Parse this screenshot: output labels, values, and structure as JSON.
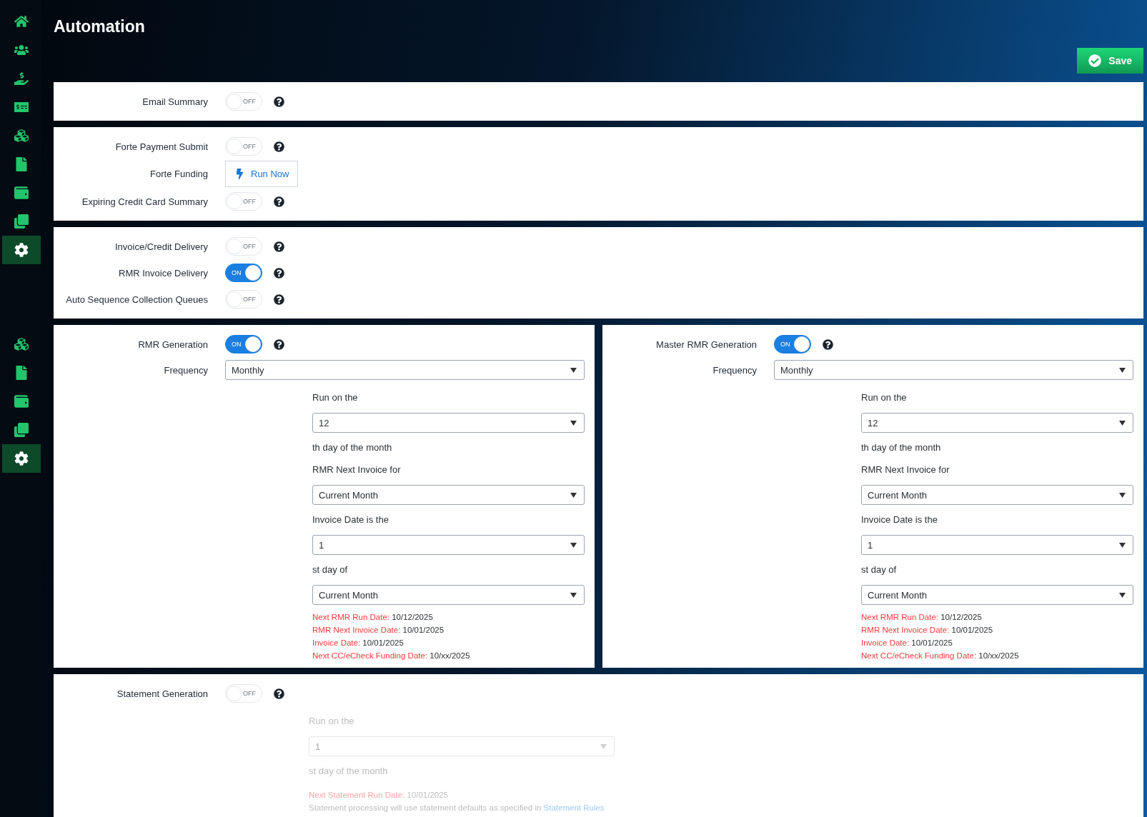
{
  "page": {
    "title": "Automation"
  },
  "save_button": {
    "label": "Save"
  },
  "sidebar": {
    "groups": [
      {
        "items": [
          {
            "kind": "home",
            "selected": false
          },
          {
            "kind": "users",
            "selected": false
          },
          {
            "kind": "payment",
            "selected": false
          },
          {
            "kind": "billing",
            "selected": false
          },
          {
            "kind": "inventory",
            "selected": false
          },
          {
            "kind": "document",
            "selected": false
          },
          {
            "kind": "wallet",
            "selected": false
          },
          {
            "kind": "copy",
            "selected": false
          },
          {
            "kind": "settings",
            "selected": true
          }
        ]
      },
      {
        "items": [
          {
            "kind": "inventory",
            "selected": false
          },
          {
            "kind": "document",
            "selected": false
          },
          {
            "kind": "wallet",
            "selected": false
          },
          {
            "kind": "copy",
            "selected": false
          },
          {
            "kind": "settings",
            "selected": true
          }
        ]
      }
    ]
  },
  "sections": [
    {
      "rows": [
        {
          "kind": "toggle",
          "label": "Email Summary",
          "on": false,
          "state": "OFF"
        }
      ]
    },
    {
      "rows": [
        {
          "kind": "toggle",
          "label": "Forte Payment Submit",
          "on": false,
          "state": "OFF"
        },
        {
          "kind": "button",
          "label": "Forte Funding",
          "button": "Run Now"
        },
        {
          "kind": "toggle",
          "label": "Expiring Credit Card Summary",
          "on": false,
          "state": "OFF"
        }
      ]
    },
    {
      "rows": [
        {
          "kind": "toggle",
          "label": "Invoice/Credit Delivery",
          "on": false,
          "state": "OFF"
        },
        {
          "kind": "toggle",
          "label": "RMR Invoice Delivery",
          "on": true,
          "state": "ON"
        },
        {
          "kind": "toggle",
          "label": "Auto Sequence Collection Queues",
          "on": false,
          "state": "OFF"
        }
      ]
    },
    {
      "columns": [
        {
          "rows": [
            {
              "kind": "toggle",
              "label": "RMR Generation",
              "on": true,
              "state": "ON"
            },
            {
              "kind": "select",
              "label": "Frequency",
              "value": "Monthly"
            }
          ],
          "details": {
            "disabled": false,
            "items": [
              {
                "kind": "text",
                "text": "Run on the"
              },
              {
                "kind": "select",
                "value": "12"
              },
              {
                "kind": "text",
                "text": "th day of the month"
              },
              {
                "kind": "text",
                "text": "RMR Next Invoice for"
              },
              {
                "kind": "select",
                "value": "Current Month"
              },
              {
                "kind": "text",
                "text": "Invoice Date is the"
              },
              {
                "kind": "select",
                "value": "1"
              },
              {
                "kind": "text",
                "text": "st day of"
              },
              {
                "kind": "select",
                "value": "Current Month"
              }
            ],
            "notes": [
              {
                "label": "Next RMR Run Date:",
                "value": "10/12/2025"
              },
              {
                "label": "RMR Next Invoice Date:",
                "value": "10/01/2025"
              },
              {
                "label": "Invoice Date:",
                "value": "10/01/2025"
              },
              {
                "label": "Next CC/eCheck Funding Date:",
                "value": "10/xx/2025"
              }
            ]
          }
        },
        {
          "rows": [
            {
              "kind": "toggle",
              "label": "Master RMR Generation",
              "on": true,
              "state": "ON"
            },
            {
              "kind": "select",
              "label": "Frequency",
              "value": "Monthly"
            }
          ],
          "details": {
            "disabled": false,
            "items": [
              {
                "kind": "text",
                "text": "Run on the"
              },
              {
                "kind": "select",
                "value": "12"
              },
              {
                "kind": "text",
                "text": "th day of the month"
              },
              {
                "kind": "text",
                "text": "RMR Next Invoice for"
              },
              {
                "kind": "select",
                "value": "Current Month"
              },
              {
                "kind": "text",
                "text": "Invoice Date is the"
              },
              {
                "kind": "select",
                "value": "1"
              },
              {
                "kind": "text",
                "text": "st day of"
              },
              {
                "kind": "select",
                "value": "Current Month"
              }
            ],
            "notes": [
              {
                "label": "Next RMR Run Date:",
                "value": "10/12/2025"
              },
              {
                "label": "RMR Next Invoice Date:",
                "value": "10/01/2025"
              },
              {
                "label": "Invoice Date:",
                "value": "10/01/2025"
              },
              {
                "label": "Next CC/eCheck Funding Date:",
                "value": "10/xx/2025"
              }
            ]
          }
        }
      ]
    },
    {
      "rows": [
        {
          "kind": "toggle",
          "label": "Statement Generation",
          "on": false,
          "state": "OFF"
        }
      ],
      "details": {
        "disabled": true,
        "items": [
          {
            "kind": "text",
            "text": "Run on the"
          },
          {
            "kind": "select",
            "value": "1"
          },
          {
            "kind": "text",
            "text": "st day of the month"
          }
        ],
        "notes": [
          {
            "label": "Next Statement Run Date:",
            "value": "10/01/2025"
          }
        ],
        "footnote": {
          "text": "Statement processing will use statement defaults as specified in ",
          "link": "Statement Rules"
        }
      }
    }
  ]
}
